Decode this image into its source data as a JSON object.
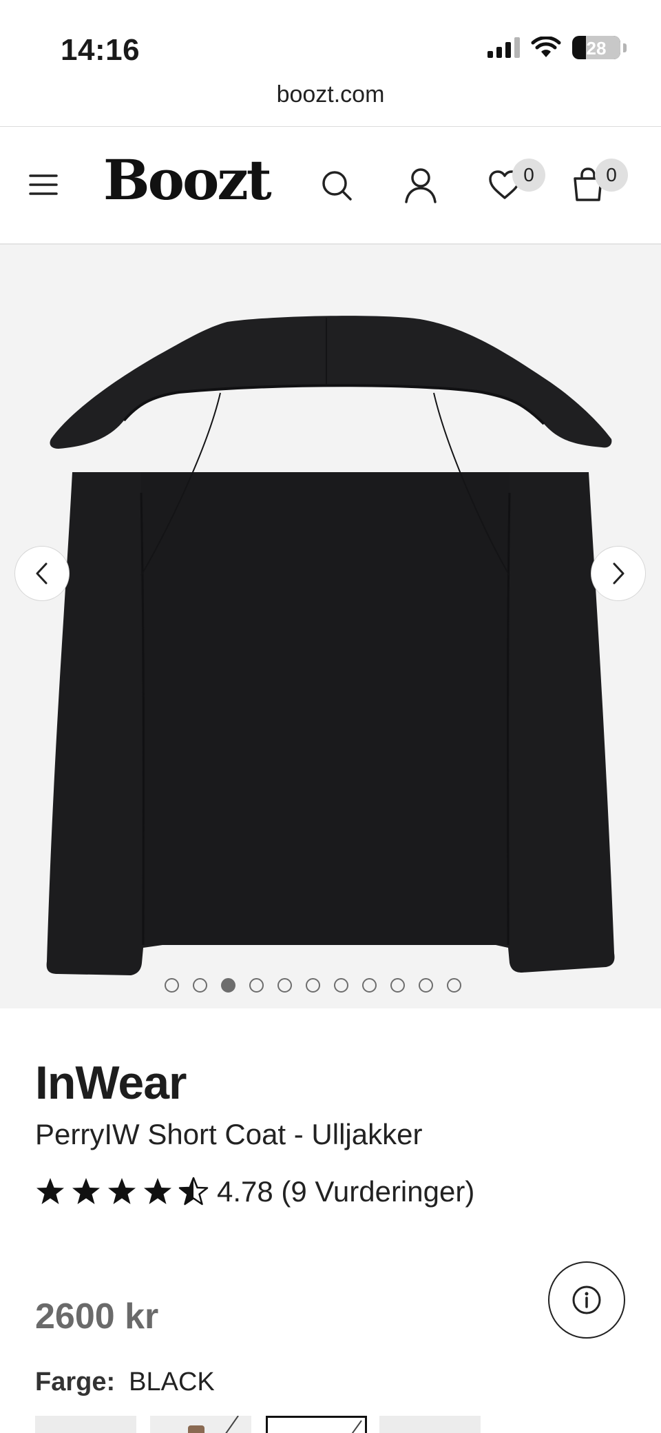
{
  "status_bar": {
    "time": "14:16",
    "battery": "28",
    "battery_level": 0.28
  },
  "browser": {
    "url": "boozt.com"
  },
  "header": {
    "logo": "Boozt",
    "wishlist_count": "0",
    "cart_count": "0",
    "icons": [
      "menu-icon",
      "search-icon",
      "account-icon",
      "heart-icon",
      "bag-icon"
    ]
  },
  "gallery": {
    "image_count": 11,
    "active_index": 2,
    "background": "#f3f3f3"
  },
  "product": {
    "brand": "InWear",
    "name": "PerryIW Short Coat - Ulljakker",
    "rating_value": 4.78,
    "rating_text": "4.78 (9 Vurderinger)",
    "price": "2600 kr",
    "color_label": "Farge:",
    "color_value": "BLACK"
  },
  "colors": {
    "price": "#6a6a6a",
    "text": "#1a1a1a"
  }
}
